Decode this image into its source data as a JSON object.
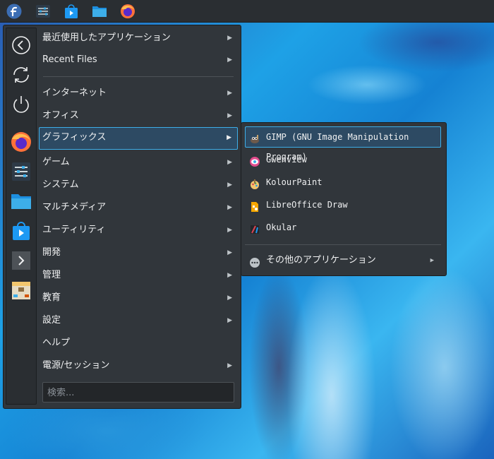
{
  "taskbar": {
    "icons": [
      "fedora-logo-icon",
      "system-settings-icon",
      "software-store-icon",
      "file-manager-icon",
      "firefox-icon"
    ]
  },
  "sidebar": {
    "buttons": [
      "back-arrow-icon",
      "refresh-icon",
      "power-icon",
      "firefox-icon",
      "system-settings-icon",
      "file-manager-icon",
      "software-store-icon",
      "terminal-icon",
      "archive-icon"
    ]
  },
  "menu": {
    "recent_apps": "最近使用したアプリケーション",
    "recent_files": "Recent Files",
    "categories": [
      {
        "label": "インターネット",
        "submenu": true
      },
      {
        "label": "オフィス",
        "submenu": true
      },
      {
        "label": "グラフィックス",
        "submenu": true,
        "selected": true
      },
      {
        "label": "ゲーム",
        "submenu": true
      },
      {
        "label": "システム",
        "submenu": true
      },
      {
        "label": "マルチメディア",
        "submenu": true
      },
      {
        "label": "ユーティリティ",
        "submenu": true
      },
      {
        "label": "開発",
        "submenu": true
      },
      {
        "label": "管理",
        "submenu": true
      },
      {
        "label": "教育",
        "submenu": true
      },
      {
        "label": "設定",
        "submenu": true
      },
      {
        "label": "ヘルプ",
        "submenu": false
      },
      {
        "label": "電源/セッション",
        "submenu": true
      }
    ],
    "search_placeholder": "検索...",
    "arrow": "▶"
  },
  "submenu": {
    "items": [
      {
        "label": "GIMP (GNU Image Manipulation Program)",
        "icon": "gimp-icon"
      },
      {
        "label": "Gwenview",
        "icon": "gwenview-icon"
      },
      {
        "label": "KolourPaint",
        "icon": "kolourpaint-icon"
      },
      {
        "label": "LibreOffice Draw",
        "icon": "libreoffice-draw-icon"
      },
      {
        "label": "Okular",
        "icon": "okular-icon"
      }
    ],
    "more": "その他のアプリケーション",
    "more_icon": "more-dots-icon"
  },
  "colors": {
    "accent": "#3daee9",
    "menu_bg": "#31363b",
    "selection_bg": "#2d4a63"
  }
}
